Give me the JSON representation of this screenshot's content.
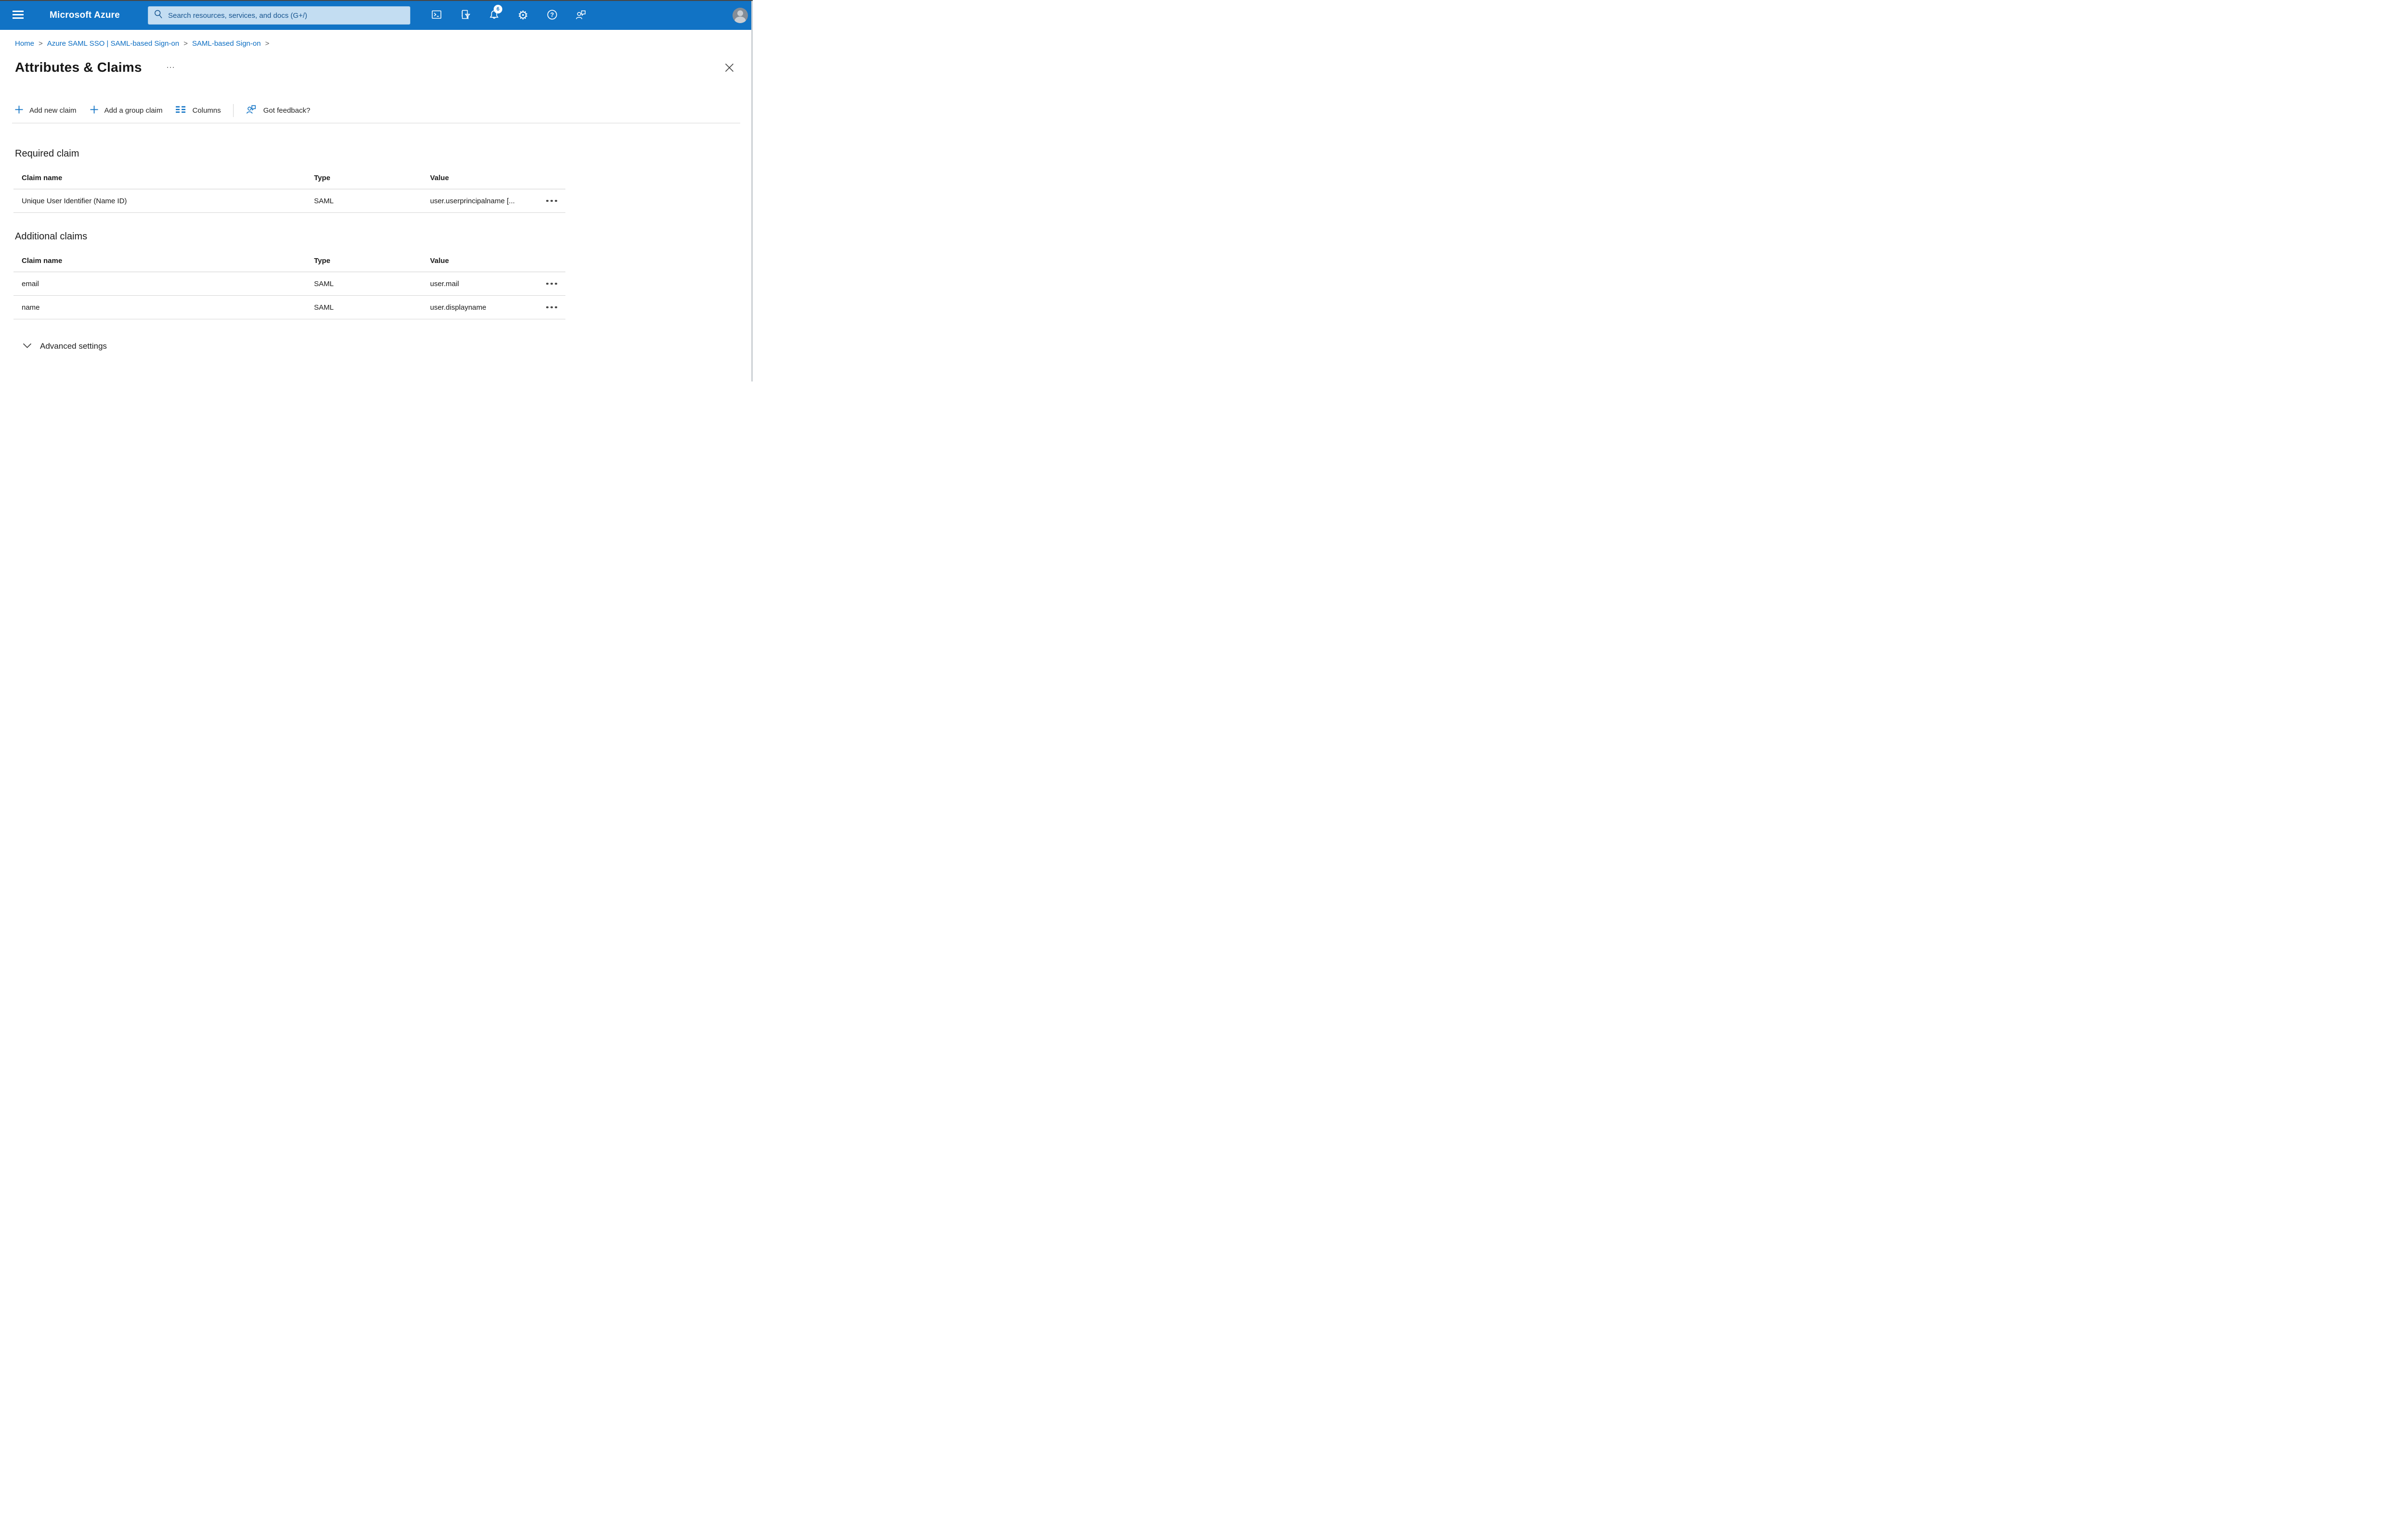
{
  "topbar": {
    "brand": "Microsoft Azure",
    "search": {
      "placeholder": "Search resources, services, and docs (G+/)"
    },
    "notifications_badge": "6",
    "icon_names": [
      "hamburger-icon",
      "search-icon",
      "cloud-shell-icon",
      "directory-filter-icon",
      "bell-icon",
      "gear-icon",
      "help-icon",
      "feedback-icon",
      "avatar-icon"
    ]
  },
  "breadcrumb": {
    "separator": ">",
    "items": [
      {
        "label": "Home"
      },
      {
        "label": "Azure SAML SSO | SAML-based Sign-on"
      },
      {
        "label": "SAML-based Sign-on"
      }
    ]
  },
  "page": {
    "title": "Attributes & Claims"
  },
  "toolbar": {
    "add_new_claim": "Add new claim",
    "add_group_claim": "Add a group claim",
    "columns": "Columns",
    "got_feedback": "Got feedback?"
  },
  "required_claim": {
    "heading": "Required claim",
    "columns": [
      "Claim name",
      "Type",
      "Value"
    ],
    "rows": [
      {
        "claim_name": "Unique User Identifier (Name ID)",
        "type": "SAML",
        "value": "user.userprincipalname [..."
      }
    ]
  },
  "additional_claims": {
    "heading": "Additional claims",
    "columns": [
      "Claim name",
      "Type",
      "Value"
    ],
    "rows": [
      {
        "claim_name": "email",
        "type": "SAML",
        "value": "user.mail"
      },
      {
        "claim_name": "name",
        "type": "SAML",
        "value": "user.displayname"
      }
    ]
  },
  "advanced_settings": {
    "label": "Advanced settings"
  },
  "colors": {
    "topbar_bg": "#1173c5",
    "search_bg": "#c3ddf2",
    "search_text": "#16548f",
    "link": "#0b6dc2",
    "text": "#1a1a1a",
    "divider": "#d6d6d6",
    "badge_bg": "#ffffff",
    "badge_text": "#1173c5"
  }
}
